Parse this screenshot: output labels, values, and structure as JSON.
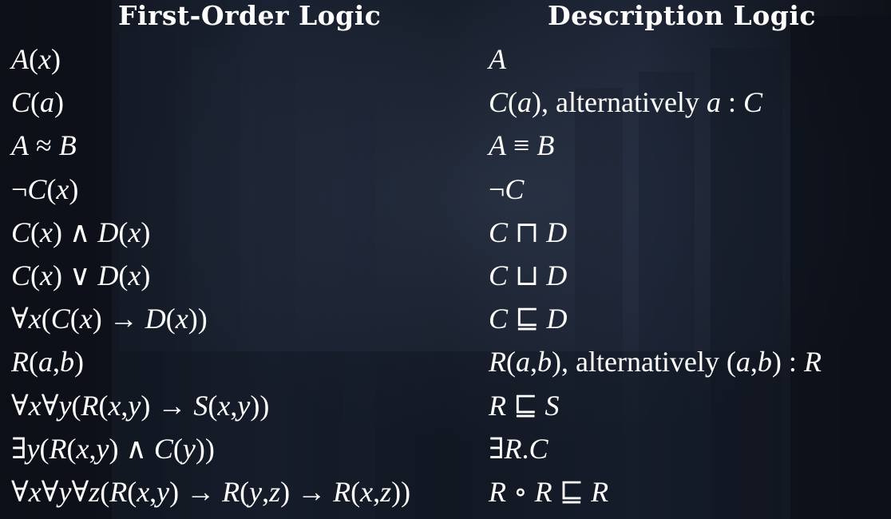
{
  "headers": {
    "fol": "First-Order Logic",
    "dl": "Description Logic"
  },
  "rows": [
    {
      "fol": "A(x)",
      "dl": "A"
    },
    {
      "fol": "C(a)",
      "dl": "C(a), alternatively a : C"
    },
    {
      "fol": "A ≈ B",
      "dl": "A ≡ B"
    },
    {
      "fol": "¬C(x)",
      "dl": "¬C"
    },
    {
      "fol": "C(x) ∧ D(x)",
      "dl": "C ⊓ D"
    },
    {
      "fol": "C(x) ∨ D(x)",
      "dl": "C ⊔ D"
    },
    {
      "fol": "∀x(C(x) → D(x))",
      "dl": "C ⊑ D"
    },
    {
      "fol": "R(a,b)",
      "dl": "R(a,b), alternatively (a,b) : R"
    },
    {
      "fol": "∀x∀y(R(x,y) → S(x,y))",
      "dl": "R ⊑ S"
    },
    {
      "fol": "∃y(R(x,y) ∧ C(y))",
      "dl": "∃R.C"
    },
    {
      "fol": "∀x∀y∀z(R(x,y) → R(y,z) → R(x,z))",
      "dl": "R ∘ R ⊑ R"
    }
  ]
}
